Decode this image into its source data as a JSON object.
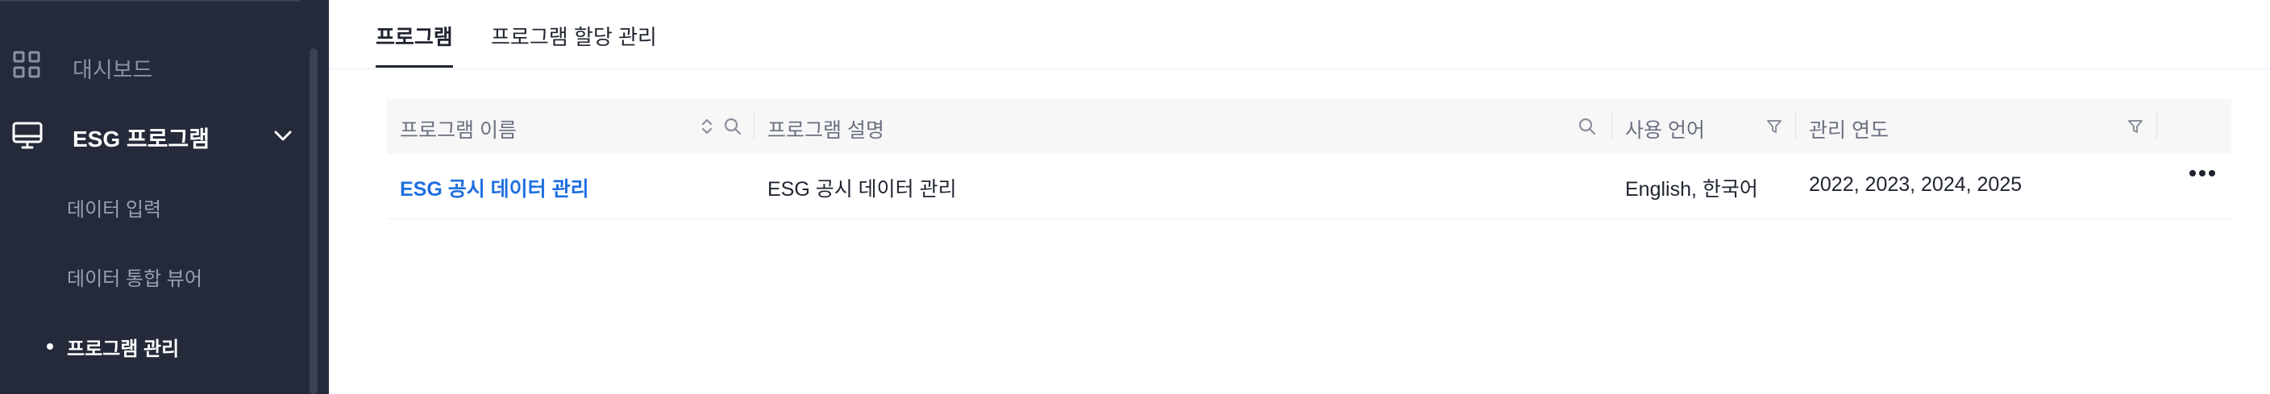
{
  "sidebar": {
    "items": [
      {
        "label": "대시보드",
        "icon": "grid-icon"
      },
      {
        "label": "ESG 프로그램",
        "icon": "monitor-icon",
        "expanded": true
      }
    ],
    "sub_items": [
      {
        "label": "데이터 입력"
      },
      {
        "label": "데이터 통합 뷰어"
      },
      {
        "label": "프로그램 관리",
        "active": true
      }
    ]
  },
  "tabs": [
    {
      "label": "프로그램",
      "active": true
    },
    {
      "label": "프로그램 할당 관리",
      "active": false
    }
  ],
  "table": {
    "columns": [
      {
        "label": "프로그램 이름",
        "controls": [
          "sort-icon",
          "search-icon"
        ]
      },
      {
        "label": "프로그램 설명",
        "controls": [
          "search-icon"
        ]
      },
      {
        "label": "사용 언어",
        "controls": [
          "filter-icon"
        ]
      },
      {
        "label": "관리 연도",
        "controls": [
          "filter-icon"
        ]
      },
      {
        "label": "",
        "controls": []
      }
    ],
    "rows": [
      {
        "name": "ESG 공시 데이터 관리",
        "description": "ESG 공시 데이터 관리",
        "languages": "English, 한국어",
        "years": "2022, 2023, 2024, 2025",
        "action_icon": "more-horizontal-icon"
      }
    ]
  },
  "colors": {
    "sidebar_bg": "#252a3a",
    "link": "#1e6fe0",
    "header_bg": "#f7f7f8"
  }
}
